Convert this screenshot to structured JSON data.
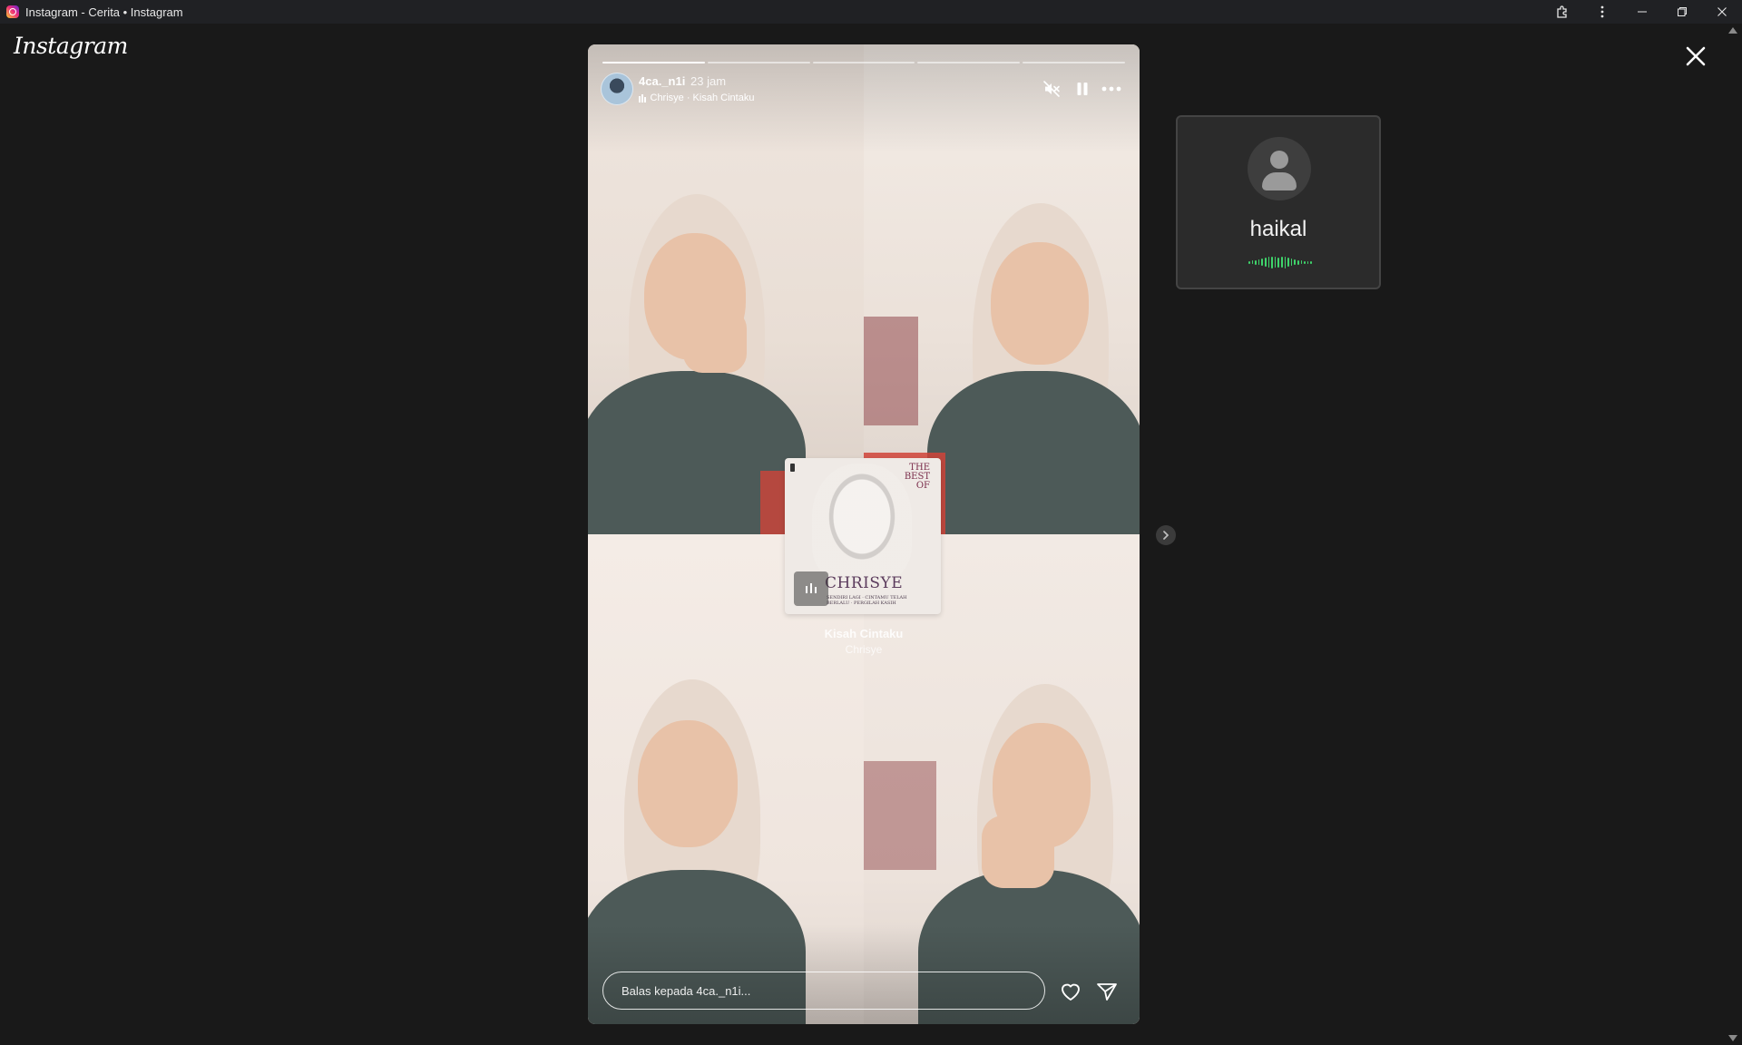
{
  "window": {
    "title": "Instagram - Cerita • Instagram",
    "app_icon": "instagram-icon",
    "buttons": [
      "extensions-icon",
      "more-vertical-icon",
      "minimize-icon",
      "restore-icon",
      "close-icon"
    ]
  },
  "brand": {
    "logo_text": "Instagram"
  },
  "story": {
    "username": "4ca._n1i",
    "timestamp": "23 jam",
    "music": {
      "artist": "Chrisye",
      "song": "Kisah Cintaku",
      "line": "Chrisye · Kisah Cintaku"
    },
    "progress": {
      "segments": 5,
      "current": 1
    },
    "controls": [
      "muted-speaker-icon",
      "pause-icon",
      "more-horizontal-icon"
    ],
    "sticker": {
      "album_top": "THE BEST OF",
      "album_artist": "CHRISYE",
      "album_lines": "SENDIRI LAGI · CINTAMU TELAH BERLALU · PERGILAH KASIH",
      "song_title": "Kisah Cintaku",
      "song_artist": "Chrisye"
    },
    "reply_placeholder": "Balas kepada 4ca._n1i...",
    "actions": [
      "heart-icon",
      "send-icon"
    ]
  },
  "call_popup": {
    "name": "haikal",
    "wave_color": "#3fd46b"
  },
  "colors": {
    "background": "#191919",
    "titlebar": "#202124"
  }
}
